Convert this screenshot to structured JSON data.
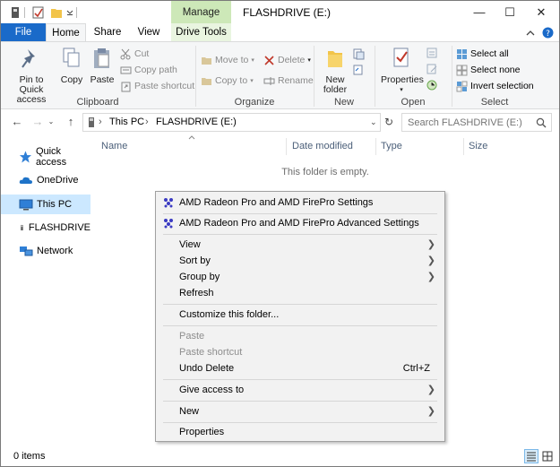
{
  "window": {
    "title": "FLASHDRIVE (E:)",
    "context_tab": "Manage",
    "controls": {
      "minimize": "—",
      "maximize": "☐",
      "close": "✕"
    }
  },
  "ribbon_tabs": {
    "file": "File",
    "home": "Home",
    "share": "Share",
    "view": "View",
    "drive_tools": "Drive Tools"
  },
  "ribbon": {
    "clipboard": {
      "label": "Clipboard",
      "pin": "Pin to Quick access",
      "copy": "Copy",
      "paste": "Paste",
      "cut": "Cut",
      "copy_path": "Copy path",
      "paste_shortcut": "Paste shortcut"
    },
    "organize": {
      "label": "Organize",
      "move_to": "Move to",
      "copy_to": "Copy to",
      "delete": "Delete",
      "rename": "Rename"
    },
    "new": {
      "label": "New",
      "new_folder": "New folder"
    },
    "open": {
      "label": "Open",
      "properties": "Properties"
    },
    "select": {
      "label": "Select",
      "select_all": "Select all",
      "select_none": "Select none",
      "invert_selection": "Invert selection"
    }
  },
  "address": {
    "crumbs": [
      "This PC",
      "FLASHDRIVE (E:)"
    ],
    "separator": "›"
  },
  "search": {
    "placeholder": "Search FLASHDRIVE (E:)"
  },
  "nav_pane": {
    "items": [
      "Quick access",
      "OneDrive",
      "This PC",
      "FLASHDRIVE",
      "Network"
    ]
  },
  "columns": {
    "name": "Name",
    "date_modified": "Date modified",
    "type": "Type",
    "size": "Size"
  },
  "empty_message": "This folder is empty.",
  "status": {
    "items": "0 items"
  },
  "context_menu": {
    "amd_settings": "AMD Radeon Pro and AMD FirePro Settings",
    "amd_advanced": "AMD Radeon Pro and AMD FirePro Advanced Settings",
    "view": "View",
    "sort_by": "Sort by",
    "group_by": "Group by",
    "refresh": "Refresh",
    "customize": "Customize this folder...",
    "paste": "Paste",
    "paste_shortcut": "Paste shortcut",
    "undo_delete": "Undo Delete",
    "undo_shortcut": "Ctrl+Z",
    "give_access": "Give access to",
    "new": "New",
    "properties": "Properties"
  },
  "colors": {
    "accent": "#1a6ac9",
    "manage_tab": "#cde8b8",
    "selection": "#cce8ff",
    "menu_bg": "#f2f2f2"
  }
}
